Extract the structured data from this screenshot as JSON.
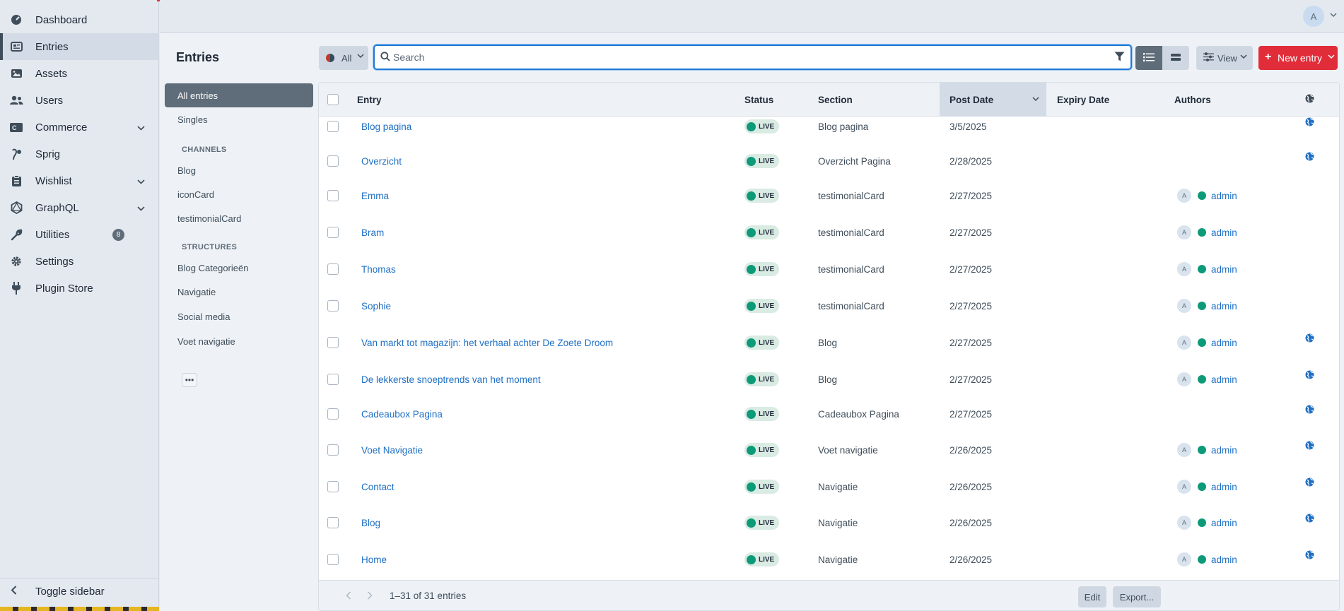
{
  "nav": {
    "items": [
      {
        "label": "Dashboard",
        "icon": "gauge-icon",
        "active": false
      },
      {
        "label": "Entries",
        "icon": "newspaper-icon",
        "active": true
      },
      {
        "label": "Assets",
        "icon": "image-icon",
        "active": false
      },
      {
        "label": "Users",
        "icon": "users-icon",
        "active": false
      },
      {
        "label": "Commerce",
        "icon": "commerce-icon",
        "active": false
      },
      {
        "label": "Sprig",
        "icon": "sprig-icon",
        "active": false
      },
      {
        "label": "Wishlist",
        "icon": "clipboard-icon",
        "active": false
      },
      {
        "label": "GraphQL",
        "icon": "graphql-icon",
        "active": false
      },
      {
        "label": "Utilities",
        "icon": "wrench-icon",
        "active": false,
        "badge": "8"
      },
      {
        "label": "Settings",
        "icon": "gear-icon",
        "active": false
      },
      {
        "label": "Plugin Store",
        "icon": "plug-icon",
        "active": false
      }
    ],
    "toggle_label": "Toggle sidebar"
  },
  "header": {
    "avatar_initial": "A"
  },
  "page": {
    "title": "Entries"
  },
  "sources": {
    "all_entries": "All entries",
    "singles": "Singles",
    "channels_heading": "CHANNELS",
    "channels": [
      "Blog",
      "iconCard",
      "testimonialCard"
    ],
    "structures_heading": "STRUCTURES",
    "structures": [
      "Blog Categorieën",
      "Navigatie",
      "Social media",
      "Voet navigatie"
    ]
  },
  "toolbar": {
    "site_label": "All",
    "search_placeholder": "Search",
    "view_label": "View",
    "new_entry_label": "New entry"
  },
  "table": {
    "columns": {
      "entry": "Entry",
      "status": "Status",
      "section": "Section",
      "post_date": "Post Date",
      "expiry_date": "Expiry Date",
      "authors": "Authors"
    },
    "rows": [
      {
        "title": "Blog pagina",
        "status": "LIVE",
        "section": "Blog pagina",
        "post_date": "3/5/2025",
        "expiry": "",
        "author_initial": "",
        "author": "",
        "globe": true
      },
      {
        "title": "Overzicht",
        "status": "LIVE",
        "section": "Overzicht Pagina",
        "post_date": "2/28/2025",
        "expiry": "",
        "author_initial": "",
        "author": "",
        "globe": true
      },
      {
        "title": "Emma",
        "status": "LIVE",
        "section": "testimonialCard",
        "post_date": "2/27/2025",
        "expiry": "",
        "author_initial": "A",
        "author": "admin",
        "globe": false
      },
      {
        "title": "Bram",
        "status": "LIVE",
        "section": "testimonialCard",
        "post_date": "2/27/2025",
        "expiry": "",
        "author_initial": "A",
        "author": "admin",
        "globe": false
      },
      {
        "title": "Thomas",
        "status": "LIVE",
        "section": "testimonialCard",
        "post_date": "2/27/2025",
        "expiry": "",
        "author_initial": "A",
        "author": "admin",
        "globe": false
      },
      {
        "title": "Sophie",
        "status": "LIVE",
        "section": "testimonialCard",
        "post_date": "2/27/2025",
        "expiry": "",
        "author_initial": "A",
        "author": "admin",
        "globe": false
      },
      {
        "title": "Van markt tot magazijn: het verhaal achter De Zoete Droom",
        "status": "LIVE",
        "section": "Blog",
        "post_date": "2/27/2025",
        "expiry": "",
        "author_initial": "A",
        "author": "admin",
        "globe": true
      },
      {
        "title": "De lekkerste snoeptrends van het moment",
        "status": "LIVE",
        "section": "Blog",
        "post_date": "2/27/2025",
        "expiry": "",
        "author_initial": "A",
        "author": "admin",
        "globe": true
      },
      {
        "title": "Cadeaubox Pagina",
        "status": "LIVE",
        "section": "Cadeaubox Pagina",
        "post_date": "2/27/2025",
        "expiry": "",
        "author_initial": "",
        "author": "",
        "globe": true
      },
      {
        "title": "Voet Navigatie",
        "status": "LIVE",
        "section": "Voet navigatie",
        "post_date": "2/26/2025",
        "expiry": "",
        "author_initial": "A",
        "author": "admin",
        "globe": true
      },
      {
        "title": "Contact",
        "status": "LIVE",
        "section": "Navigatie",
        "post_date": "2/26/2025",
        "expiry": "",
        "author_initial": "A",
        "author": "admin",
        "globe": true
      },
      {
        "title": "Blog",
        "status": "LIVE",
        "section": "Navigatie",
        "post_date": "2/26/2025",
        "expiry": "",
        "author_initial": "A",
        "author": "admin",
        "globe": true
      },
      {
        "title": "Home",
        "status": "LIVE",
        "section": "Navigatie",
        "post_date": "2/26/2025",
        "expiry": "",
        "author_initial": "A",
        "author": "admin",
        "globe": true
      }
    ]
  },
  "footer": {
    "pagination": "1–31 of 31 entries",
    "edit_label": "Edit",
    "export_label": "Export..."
  },
  "colors": {
    "accent": "#1e6fc4",
    "primary_button": "#e12d39",
    "live": "#0d9a78",
    "sidebar_bg": "#e4e9ef"
  }
}
